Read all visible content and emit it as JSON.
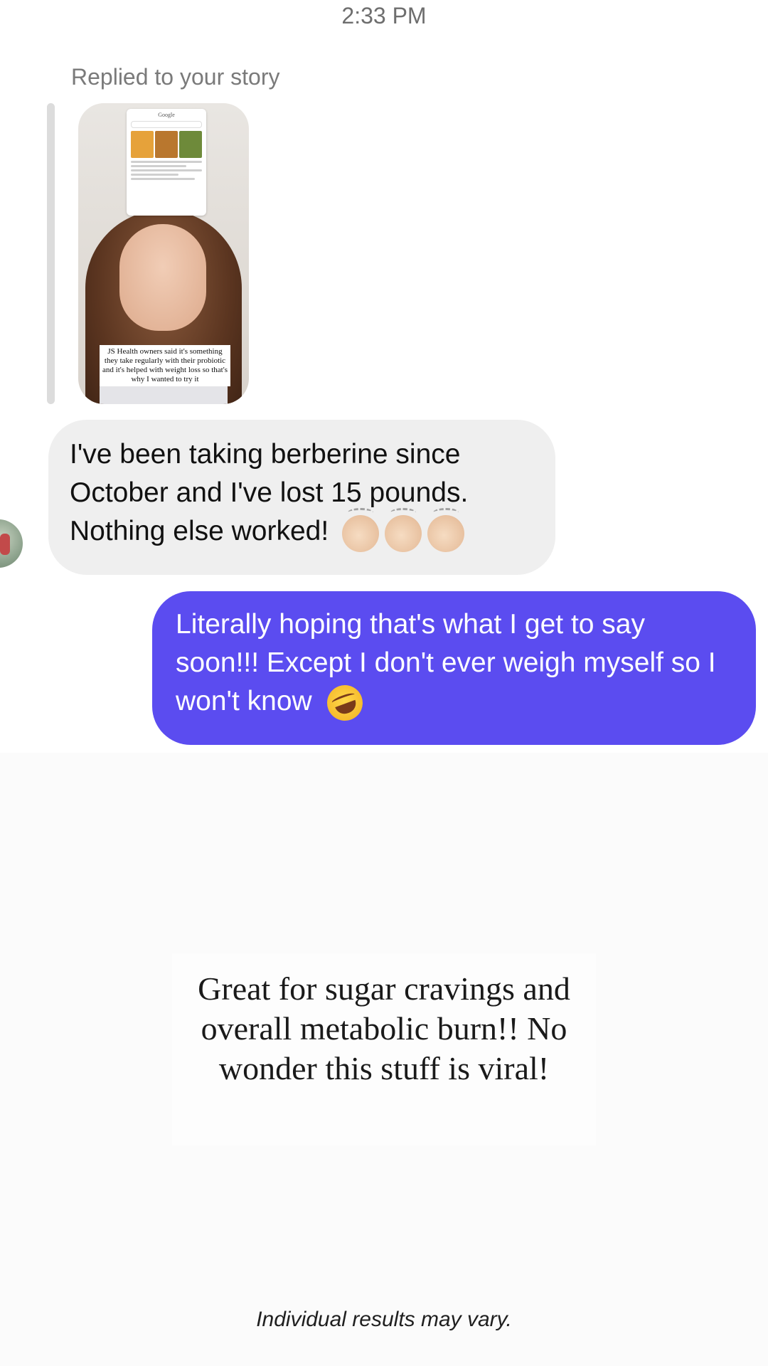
{
  "header": {
    "time": "2:33 PM"
  },
  "story_reply": {
    "label": "Replied to your story",
    "thumbnail": {
      "phone_title": "Google",
      "caption": "JS Health owners said it's something they take regularly with their probiotic and it's helped with weight loss so that's why I wanted to try it"
    }
  },
  "messages": {
    "incoming": {
      "text": "I've been taking berberine since October and I've lost 15 pounds. Nothing else worked!",
      "emoji": "clapping-hands x3",
      "bubble_color": "#efefef"
    },
    "outgoing": {
      "text": "Literally hoping that's what I get to say soon!!! Except I don't ever weigh myself so I won't know",
      "emoji": "rolling-on-floor-laughing",
      "bubble_color": "#5b4cf0"
    }
  },
  "overlay": {
    "headline": "Great for sugar cravings and overall metabolic burn!! No wonder this stuff is viral!"
  },
  "footer": {
    "disclaimer": "Individual results may vary."
  }
}
